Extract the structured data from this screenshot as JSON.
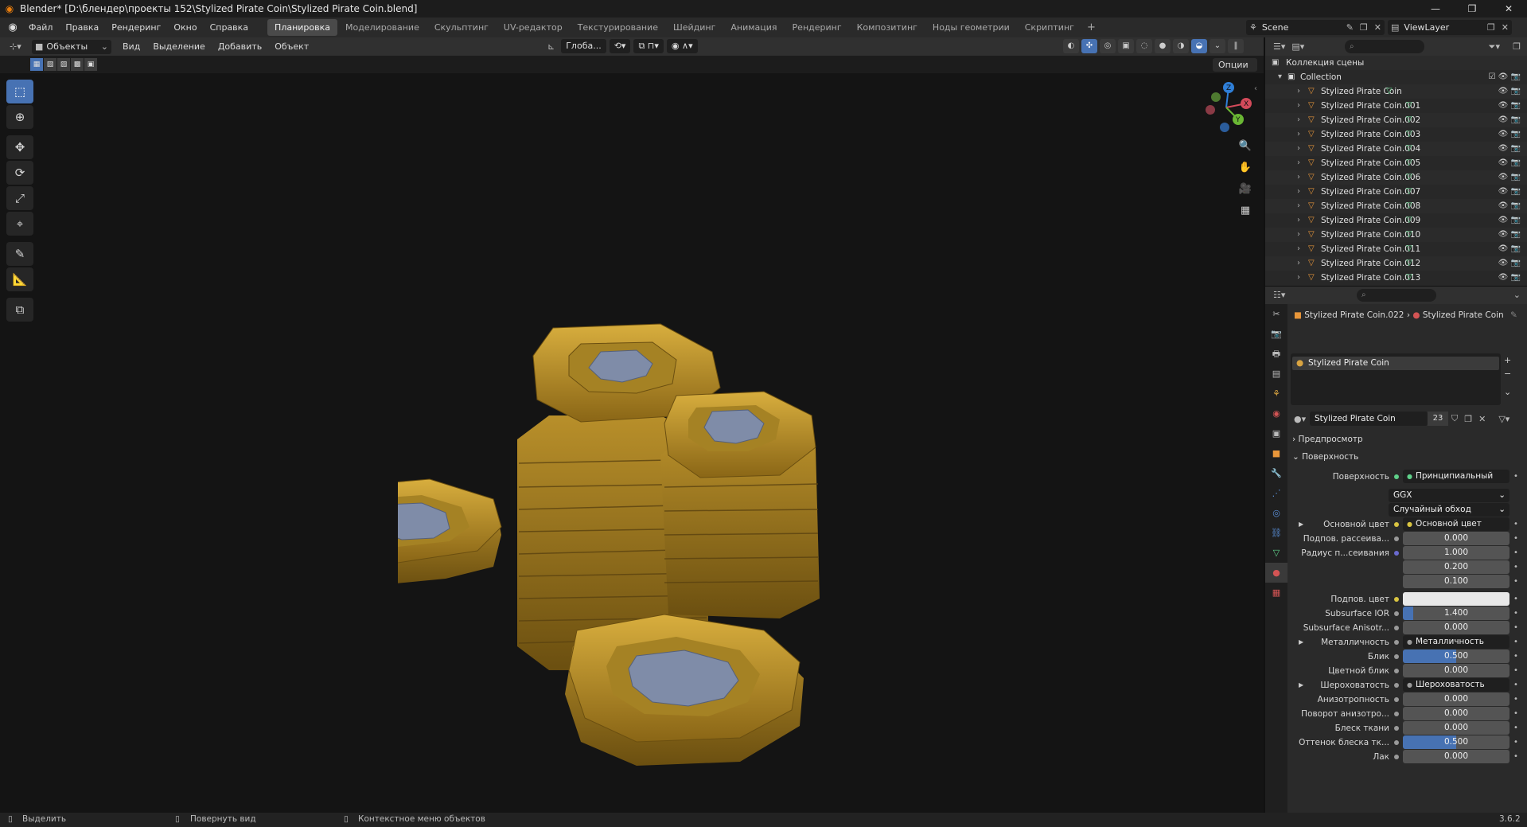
{
  "titlebar": {
    "title": "Blender* [D:\\блендер\\проекты 152\\Stylized Pirate Coin\\Stylized Pirate Coin.blend]",
    "minimize": "—",
    "maximize": "❐",
    "close": "✕"
  },
  "menu": [
    "Файл",
    "Правка",
    "Рендеринг",
    "Окно",
    "Справка"
  ],
  "workspaces": [
    "Планировка",
    "Моделирование",
    "Скульптинг",
    "UV-редактор",
    "Текстурирование",
    "Шейдинг",
    "Анимация",
    "Рендеринг",
    "Композитинг",
    "Ноды геометрии",
    "Скриптинг"
  ],
  "active_workspace": "Планировка",
  "scene": "Scene",
  "view_layer": "ViewLayer",
  "viewport_header": {
    "mode": "Объекты",
    "menus": [
      "Вид",
      "Выделение",
      "Добавить",
      "Объект"
    ],
    "transform_orientation": "Глоба...",
    "options": "Опции"
  },
  "outliner": {
    "root": "Коллекция сцены",
    "collection": "Collection",
    "items": [
      "Stylized Pirate Coin",
      "Stylized Pirate Coin.001",
      "Stylized Pirate Coin.002",
      "Stylized Pirate Coin.003",
      "Stylized Pirate Coin.004",
      "Stylized Pirate Coin.005",
      "Stylized Pirate Coin.006",
      "Stylized Pirate Coin.007",
      "Stylized Pirate Coin.008",
      "Stylized Pirate Coin.009",
      "Stylized Pirate Coin.010",
      "Stylized Pirate Coin.011",
      "Stylized Pirate Coin.012",
      "Stylized Pirate Coin.013"
    ]
  },
  "properties": {
    "breadcrumb_object": "Stylized Pirate Coin.022",
    "breadcrumb_material": "Stylized Pirate Coin",
    "slot": "Stylized Pirate Coin",
    "material_name": "Stylized Pirate Coin",
    "material_users": "23",
    "preview_label": "Предпросмотр",
    "surface_panel": "Поверхность",
    "surface_label": "Поверхность",
    "surface_value": "Принципиальный BSDF",
    "distribution": "GGX",
    "subsurface_method": "Случайный обход",
    "rows": {
      "base_color_label": "Основной цвет",
      "base_color_value": "Основной цвет",
      "subsurface_label": "Подпов. рассеива...",
      "subsurface_value": "0.000",
      "radius_label": "Радиус п...сеивания",
      "radius_x": "1.000",
      "radius_y": "0.200",
      "radius_z": "0.100",
      "subsurface_color_label": "Подпов. цвет",
      "ior_label": "Subsurface IOR",
      "ior_value": "1.400",
      "aniso_label": "Subsurface Anisotr...",
      "aniso_value": "0.000",
      "metallic_label": "Металличность",
      "metallic_value": "Металличность",
      "specular_label": "Блик",
      "specular_value": "0.500",
      "spec_tint_label": "Цветной блик",
      "spec_tint_value": "0.000",
      "roughness_label": "Шероховатость",
      "roughness_value": "Шероховатость",
      "anisotropic_label": "Анизотропность",
      "anisotropic_value": "0.000",
      "aniso_rot_label": "Поворот анизотро...",
      "aniso_rot_value": "0.000",
      "sheen_label": "Блеск ткани",
      "sheen_value": "0.000",
      "sheen_tint_label": "Оттенок блеска тк...",
      "sheen_tint_value": "0.500",
      "clearcoat_label": "Лак",
      "clearcoat_value": "0.000"
    },
    "fills": {
      "ior": 0.1,
      "specular": 0.5,
      "sheen_tint": 0.5
    }
  },
  "statusbar": {
    "select": "Выделить",
    "rotate": "Повернуть вид",
    "context": "Контекстное меню объектов",
    "version": "3.6.2"
  },
  "colors": {
    "accent": "#4772b3",
    "coin_gold": "#b8902a",
    "coin_center": "#7d8aa5",
    "object_icon": "#e8963a",
    "mesh_icon": "#5fd18a"
  }
}
